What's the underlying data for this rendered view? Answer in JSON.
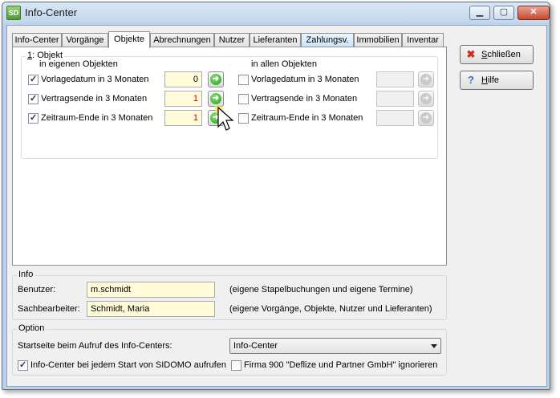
{
  "window": {
    "title": "Info-Center",
    "icon_text": "SD",
    "minimize_icon": "minimize-icon",
    "maximize_icon": "maximize-icon",
    "close_icon": "close-icon"
  },
  "tabs": [
    {
      "label": "Info-Center",
      "active": false
    },
    {
      "label": "Vorgänge",
      "active": false
    },
    {
      "label": "Objekte",
      "active": true
    },
    {
      "label": "Abrechnungen",
      "active": false
    },
    {
      "label": "Nutzer",
      "active": false
    },
    {
      "label": "Lieferanten",
      "active": false
    },
    {
      "label": "Zahlungsv.",
      "active": false
    },
    {
      "label": "Immobilien",
      "active": false
    },
    {
      "label": "Inventar",
      "active": false
    }
  ],
  "objekt_group": {
    "label_prefix": "1",
    "label_rest": ": Objekt",
    "own_heading": "in eigenen Objekten",
    "all_heading": "in allen Objekten",
    "own_rows": [
      {
        "label": "Vorlagedatum in 3 Monaten",
        "checked": true,
        "value": "0"
      },
      {
        "label": "Vertragsende in 3 Monaten",
        "checked": true,
        "value": "1"
      },
      {
        "label": "Zeitraum-Ende in 3 Monaten",
        "checked": true,
        "value": "1"
      }
    ],
    "all_rows": [
      {
        "label": "Vorlagedatum in 3 Monaten",
        "checked": false,
        "value": ""
      },
      {
        "label": "Vertragsende in 3 Monaten",
        "checked": false,
        "value": ""
      },
      {
        "label": "Zeitraum-Ende in 3 Monaten",
        "checked": false,
        "value": ""
      }
    ]
  },
  "buttons": {
    "close_label": "Schließen",
    "close_mnemonic": "S",
    "close_label_rest": "chließen",
    "help_label": "Hilfe",
    "help_mnemonic": "H",
    "help_label_rest": "ilfe",
    "close_icon": "red-x-icon",
    "help_icon": "question-mark-icon"
  },
  "info": {
    "title": "Info",
    "user_label": "Benutzer:",
    "user_value": "m.schmidt",
    "user_note": "(eigene Stapelbuchungen und eigene Termine)",
    "clerk_label": "Sachbearbeiter:",
    "clerk_value": "Schmidt, Maria",
    "clerk_note": "(eigene Vorgänge, Objekte, Nutzer und Lieferanten)"
  },
  "option": {
    "title": "Option",
    "start_label": "Startseite beim Aufruf des Info-Centers:",
    "start_value": "Info-Center",
    "open_each_start_label": "Info-Center bei jedem Start von SIDOMO aufrufen",
    "open_each_start_checked": true,
    "ignore_company_label": "Firma 900 \"Deflize und Partner GmbH\" ignorieren",
    "ignore_company_checked": false
  },
  "colors": {
    "field_yellow": "#fffbd9",
    "value_red": "#c00000",
    "go_green": "#239a1b",
    "frame_blue": "#bcd2ea"
  }
}
